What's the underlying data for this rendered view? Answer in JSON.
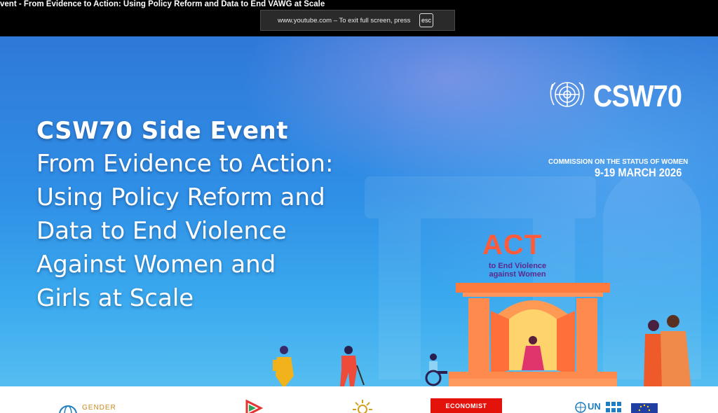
{
  "window": {
    "video_title": "vent - From Evidence to Action: Using Policy Reform and Data to End VAWG at Scale"
  },
  "fullscreen_notice": {
    "message": "www.youtube.com – To exit full screen, press",
    "key": "esc"
  },
  "slide": {
    "headline": {
      "line1": "CSW70 Side Event",
      "line2": "From Evidence to Action:",
      "line3": "Using Policy Reform and",
      "line4": "Data to End Violence",
      "line5": "Against Women and",
      "line6": "Girls at Scale"
    },
    "branding": {
      "name": "CSW70",
      "commission": "COMMISSION ON THE STATUS OF WOMEN",
      "dates": "9-19 MARCH 2026"
    },
    "campaign": {
      "title": "ACT",
      "subtitle": "to End Violence against Women"
    }
  },
  "partner_logos": {
    "gender": "GENDER",
    "economist": "ECONOMIST",
    "un": "UN"
  },
  "colors": {
    "slide_blue": "#2f8fe6",
    "act_orange": "#ff5b3b",
    "act_purple": "#5b2a8c",
    "economist_red": "#e3120b",
    "eu_blue": "#1f3fa3"
  }
}
